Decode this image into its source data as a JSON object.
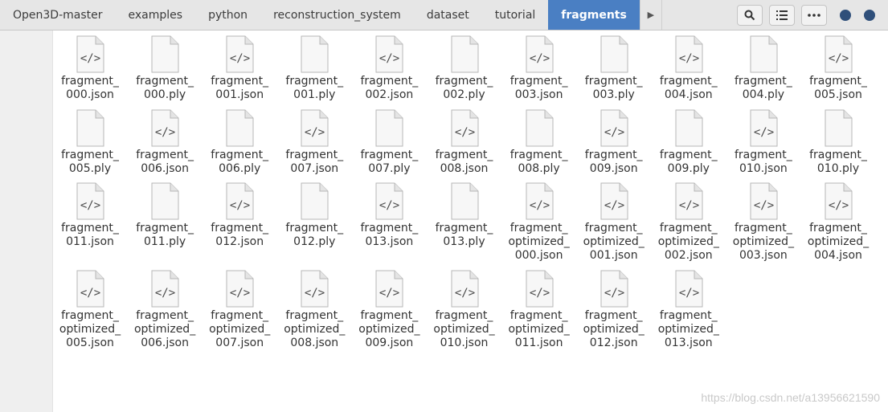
{
  "breadcrumbs": [
    "Open3D-master",
    "examples",
    "python",
    "reconstruction_system",
    "dataset",
    "tutorial",
    "fragments"
  ],
  "toolbar": {
    "search_icon": "search-icon",
    "view_icon": "list-view-icon",
    "menu_icon": "more-menu-icon"
  },
  "colors": {
    "accent": "#4a7fc3",
    "topbar": "#e6e6e6",
    "sidebar": "#efefef"
  },
  "files": [
    {
      "lines": [
        "fragment_",
        "000.json"
      ],
      "kind": "json"
    },
    {
      "lines": [
        "fragment_",
        "000.ply"
      ],
      "kind": "ply"
    },
    {
      "lines": [
        "fragment_",
        "001.json"
      ],
      "kind": "json"
    },
    {
      "lines": [
        "fragment_",
        "001.ply"
      ],
      "kind": "ply"
    },
    {
      "lines": [
        "fragment_",
        "002.json"
      ],
      "kind": "json"
    },
    {
      "lines": [
        "fragment_",
        "002.ply"
      ],
      "kind": "ply"
    },
    {
      "lines": [
        "fragment_",
        "003.json"
      ],
      "kind": "json"
    },
    {
      "lines": [
        "fragment_",
        "003.ply"
      ],
      "kind": "ply"
    },
    {
      "lines": [
        "fragment_",
        "004.json"
      ],
      "kind": "json"
    },
    {
      "lines": [
        "fragment_",
        "004.ply"
      ],
      "kind": "ply"
    },
    {
      "lines": [
        "fragment_",
        "005.json"
      ],
      "kind": "json"
    },
    {
      "lines": [
        "fragment_",
        "005.ply"
      ],
      "kind": "ply"
    },
    {
      "lines": [
        "fragment_",
        "006.json"
      ],
      "kind": "json"
    },
    {
      "lines": [
        "fragment_",
        "006.ply"
      ],
      "kind": "ply"
    },
    {
      "lines": [
        "fragment_",
        "007.json"
      ],
      "kind": "json"
    },
    {
      "lines": [
        "fragment_",
        "007.ply"
      ],
      "kind": "ply"
    },
    {
      "lines": [
        "fragment_",
        "008.json"
      ],
      "kind": "json"
    },
    {
      "lines": [
        "fragment_",
        "008.ply"
      ],
      "kind": "ply"
    },
    {
      "lines": [
        "fragment_",
        "009.json"
      ],
      "kind": "json"
    },
    {
      "lines": [
        "fragment_",
        "009.ply"
      ],
      "kind": "ply"
    },
    {
      "lines": [
        "fragment_",
        "010.json"
      ],
      "kind": "json"
    },
    {
      "lines": [
        "fragment_",
        "010.ply"
      ],
      "kind": "ply"
    },
    {
      "lines": [
        "fragment_",
        "011.json"
      ],
      "kind": "json"
    },
    {
      "lines": [
        "fragment_",
        "011.ply"
      ],
      "kind": "ply"
    },
    {
      "lines": [
        "fragment_",
        "012.json"
      ],
      "kind": "json"
    },
    {
      "lines": [
        "fragment_",
        "012.ply"
      ],
      "kind": "ply"
    },
    {
      "lines": [
        "fragment_",
        "013.json"
      ],
      "kind": "json"
    },
    {
      "lines": [
        "fragment_",
        "013.ply"
      ],
      "kind": "ply"
    },
    {
      "lines": [
        "fragment_",
        "optimized_",
        "000.json"
      ],
      "kind": "json"
    },
    {
      "lines": [
        "fragment_",
        "optimized_",
        "001.json"
      ],
      "kind": "json"
    },
    {
      "lines": [
        "fragment_",
        "optimized_",
        "002.json"
      ],
      "kind": "json"
    },
    {
      "lines": [
        "fragment_",
        "optimized_",
        "003.json"
      ],
      "kind": "json"
    },
    {
      "lines": [
        "fragment_",
        "optimized_",
        "004.json"
      ],
      "kind": "json"
    },
    {
      "lines": [
        "fragment_",
        "optimized_",
        "005.json"
      ],
      "kind": "json"
    },
    {
      "lines": [
        "fragment_",
        "optimized_",
        "006.json"
      ],
      "kind": "json"
    },
    {
      "lines": [
        "fragment_",
        "optimized_",
        "007.json"
      ],
      "kind": "json"
    },
    {
      "lines": [
        "fragment_",
        "optimized_",
        "008.json"
      ],
      "kind": "json"
    },
    {
      "lines": [
        "fragment_",
        "optimized_",
        "009.json"
      ],
      "kind": "json"
    },
    {
      "lines": [
        "fragment_",
        "optimized_",
        "010.json"
      ],
      "kind": "json"
    },
    {
      "lines": [
        "fragment_",
        "optimized_",
        "011.json"
      ],
      "kind": "json"
    },
    {
      "lines": [
        "fragment_",
        "optimized_",
        "012.json"
      ],
      "kind": "json"
    },
    {
      "lines": [
        "fragment_",
        "optimized_",
        "013.json"
      ],
      "kind": "json"
    }
  ],
  "watermark": "https://blog.csdn.net/a13956621590"
}
